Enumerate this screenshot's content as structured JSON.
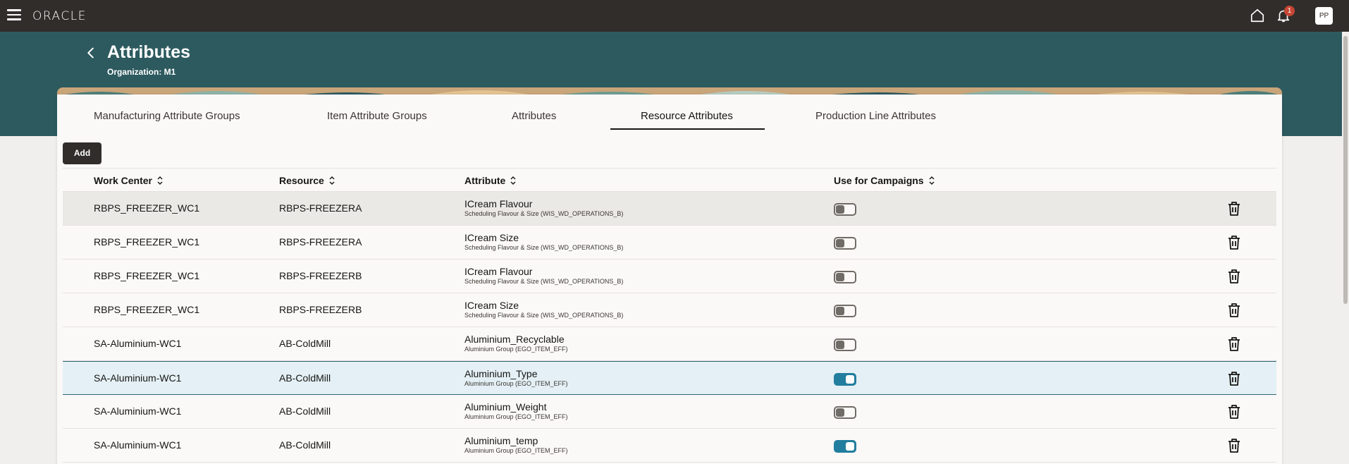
{
  "header": {
    "logo": "ORACLE",
    "notification_count": "1",
    "user_initials": "PP"
  },
  "page": {
    "title": "Attributes",
    "subtitle": "Organization: M1"
  },
  "tabs": [
    {
      "label": "Manufacturing Attribute Groups"
    },
    {
      "label": "Item Attribute Groups"
    },
    {
      "label": "Attributes"
    },
    {
      "label": "Resource Attributes",
      "active": true
    },
    {
      "label": "Production Line Attributes"
    }
  ],
  "toolbar": {
    "add_label": "Add"
  },
  "table": {
    "columns": [
      "Work Center",
      "Resource",
      "Attribute",
      "Use for Campaigns"
    ],
    "rows": [
      {
        "work_center": "RBPS_FREEZER_WC1",
        "resource": "RBPS-FREEZERA",
        "attribute": "ICream Flavour",
        "attribute_group": "Scheduling Flavour & Size (WIS_WD_OPERATIONS_B)",
        "use_for_campaigns": false
      },
      {
        "work_center": "RBPS_FREEZER_WC1",
        "resource": "RBPS-FREEZERA",
        "attribute": "ICream Size",
        "attribute_group": "Scheduling Flavour & Size (WIS_WD_OPERATIONS_B)",
        "use_for_campaigns": false
      },
      {
        "work_center": "RBPS_FREEZER_WC1",
        "resource": "RBPS-FREEZERB",
        "attribute": "ICream Flavour",
        "attribute_group": "Scheduling Flavour & Size (WIS_WD_OPERATIONS_B)",
        "use_for_campaigns": false
      },
      {
        "work_center": "RBPS_FREEZER_WC1",
        "resource": "RBPS-FREEZERB",
        "attribute": "ICream Size",
        "attribute_group": "Scheduling Flavour & Size (WIS_WD_OPERATIONS_B)",
        "use_for_campaigns": false
      },
      {
        "work_center": "SA-Aluminium-WC1",
        "resource": "AB-ColdMill",
        "attribute": "Aluminium_Recyclable",
        "attribute_group": "Aluminium Group (EGO_ITEM_EFF)",
        "use_for_campaigns": false
      },
      {
        "work_center": "SA-Aluminium-WC1",
        "resource": "AB-ColdMill",
        "attribute": "Aluminium_Type",
        "attribute_group": "Aluminium Group (EGO_ITEM_EFF)",
        "use_for_campaigns": true
      },
      {
        "work_center": "SA-Aluminium-WC1",
        "resource": "AB-ColdMill",
        "attribute": "Aluminium_Weight",
        "attribute_group": "Aluminium Group (EGO_ITEM_EFF)",
        "use_for_campaigns": false
      },
      {
        "work_center": "SA-Aluminium-WC1",
        "resource": "AB-ColdMill",
        "attribute": "Aluminium_temp",
        "attribute_group": "Aluminium Group (EGO_ITEM_EFF)",
        "use_for_campaigns": true
      }
    ]
  },
  "colors": {
    "header_bg": "#312d2a",
    "banner_bg": "#2d5a5f",
    "toggle_on": "#227e9e",
    "badge": "#c74634"
  }
}
